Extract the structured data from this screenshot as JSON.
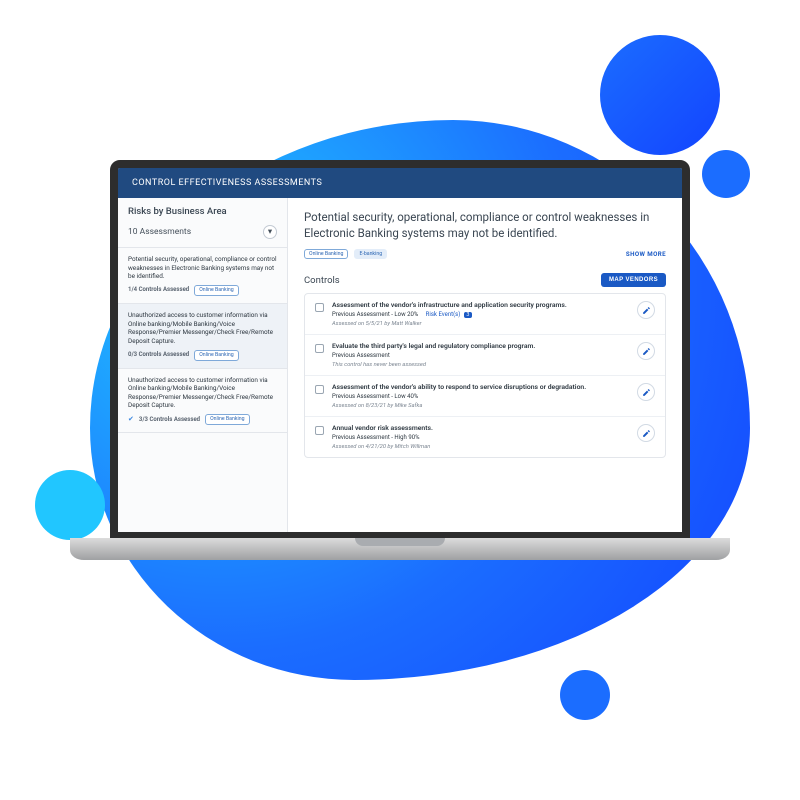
{
  "header": {
    "title": "CONTROL EFFECTIVENESS ASSESSMENTS"
  },
  "sidebar": {
    "heading": "Risks by Business Area",
    "count_label": "10 Assessments",
    "risks": [
      {
        "text": "Potential security, operational, compliance or control weaknesses in Electronic Banking systems may not be identified.",
        "count": "1/4 Controls Assessed",
        "tag": "Online Banking",
        "checked": false
      },
      {
        "text": "Unauthorized access to customer information via Online banking/Mobile Banking/Voice Response/Premier Messenger/Check Free/Remote Deposit Capture.",
        "count": "0/3 Controls Assessed",
        "tag": "Online Banking",
        "checked": false
      },
      {
        "text": "Unauthorized access to customer information via Online banking/Mobile Banking/Voice Response/Premier Messenger/Check Free/Remote Deposit Capture.",
        "count": "3/3 Controls Assessed",
        "tag": "Online Banking",
        "checked": true
      }
    ]
  },
  "main": {
    "title": "Potential security, operational, compliance or control weaknesses in Electronic Banking systems may not be identified.",
    "tags": [
      "Online Banking",
      "E-banking"
    ],
    "show_more": "SHOW MORE",
    "controls_heading": "Controls",
    "map_vendors": "MAP VENDORS",
    "controls": [
      {
        "title": "Assessment of the vendor's infrastructure and application security programs.",
        "prev_label": "Previous Assessment - Low 20%",
        "risk_events_label": "Risk Event(s)",
        "risk_events_count": "3",
        "meta": "Assessed on 5/5/21 by Matt Walker"
      },
      {
        "title": "Evaluate the third party's legal and regulatory compliance program.",
        "prev_label": "Previous Assessment",
        "risk_events_label": "",
        "risk_events_count": "",
        "meta": "This control has never been assessed"
      },
      {
        "title": "Assessment of the vendor's ability to respond to service disruptions or degradation.",
        "prev_label": "Previous Assessment - Low 40%",
        "risk_events_label": "",
        "risk_events_count": "",
        "meta": "Assessed on 8/23/21 by Mike Safka"
      },
      {
        "title": "Annual vendor risk assessments.",
        "prev_label": "Previous Assessment - High 90%",
        "risk_events_label": "",
        "risk_events_count": "",
        "meta": "Assessed on 4/21/20 by Mitch Willman"
      }
    ]
  }
}
